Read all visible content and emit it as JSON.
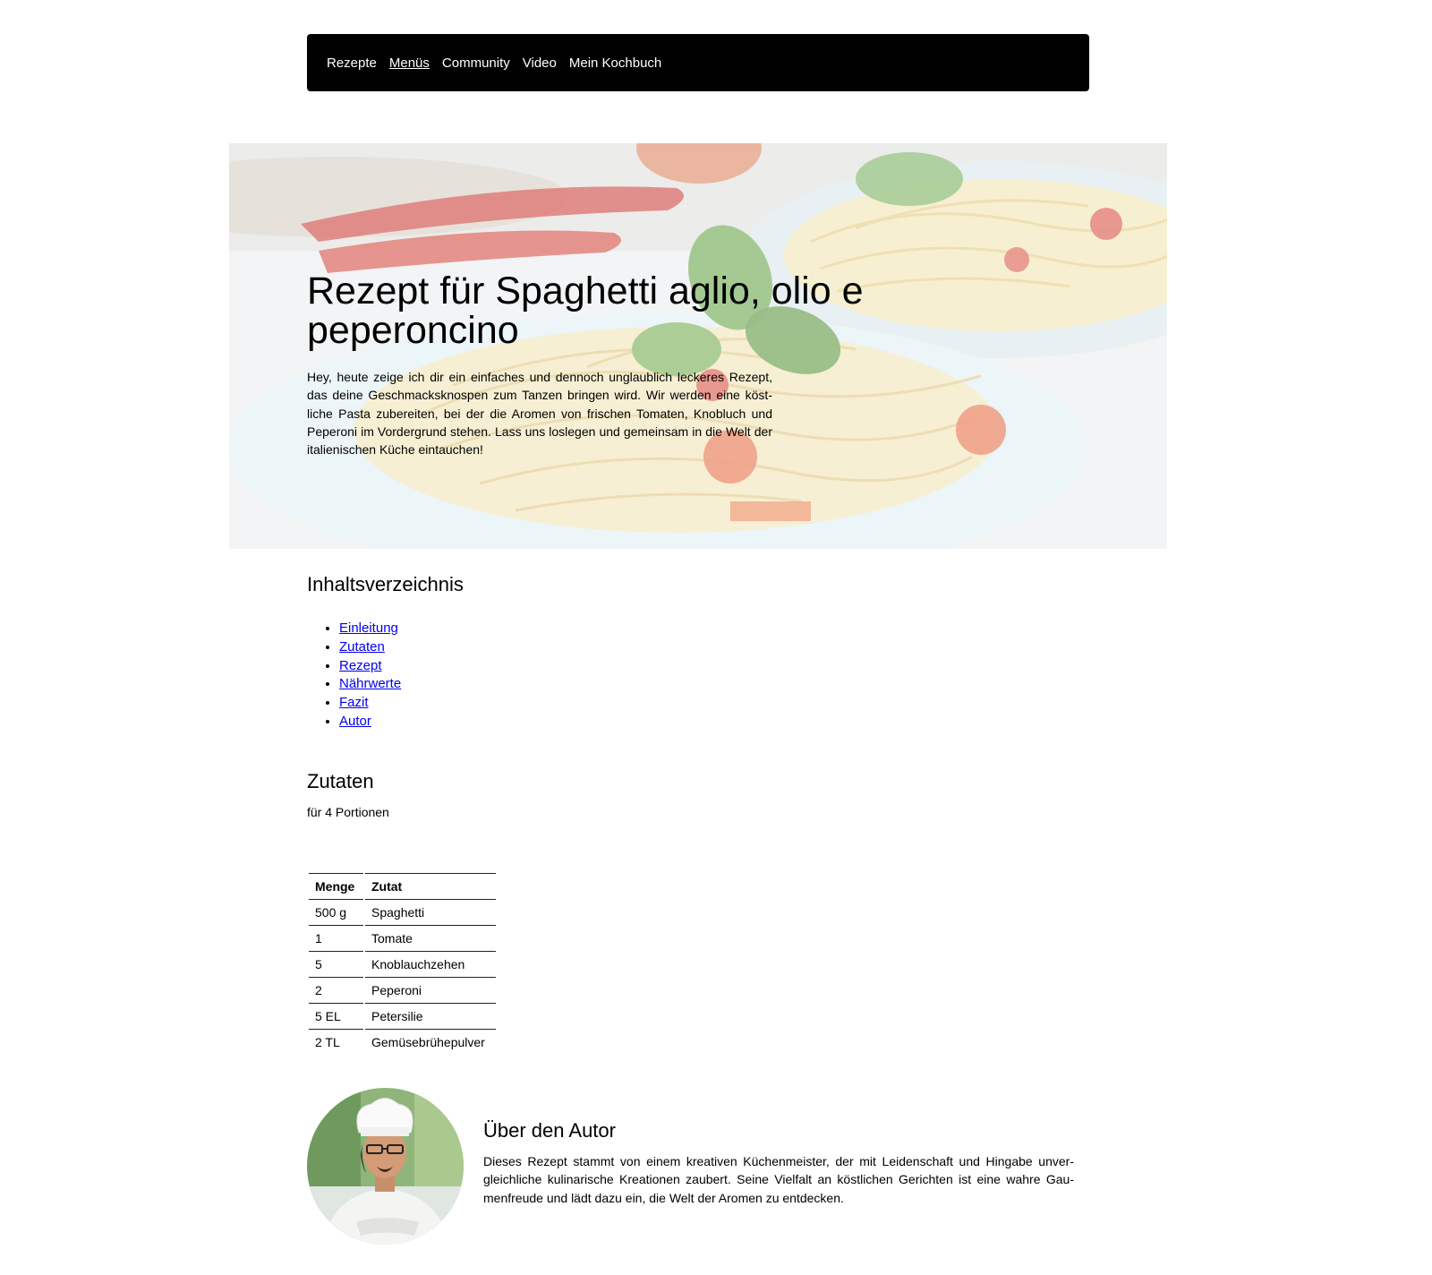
{
  "nav": {
    "items": [
      {
        "label": "Rezepte",
        "active": false
      },
      {
        "label": "Menüs",
        "active": true
      },
      {
        "label": "Community",
        "active": false
      },
      {
        "label": "Video",
        "active": false
      },
      {
        "label": "Mein Kochbuch",
        "active": false
      }
    ]
  },
  "hero": {
    "title": "Rezept für Spaghetti aglio, olio e peperoncino",
    "text": "Hey, heute zeige ich dir ein einfaches und dennoch unglaublich leckeres Rezept, das deine Geschmacksknospen zum Tanzen bringen wird. Wir werden eine köst-liche Pasta zubereiten, bei der die Aromen von frischen Tomaten, Knobluch und Peperoni im Vordergrund stehen. Lass uns loslegen und gemeinsam in die Welt der italienischen Küche eintauchen!"
  },
  "toc": {
    "heading": "Inhaltsverzeichnis",
    "items": [
      "Einleitung",
      "Zutaten",
      "Rezept",
      "Nährwerte",
      "Fazit",
      "Autor"
    ]
  },
  "ingredients": {
    "heading": "Zutaten",
    "portions": "für 4 Portionen",
    "columns": [
      "Menge",
      "Zutat"
    ],
    "rows": [
      [
        "500 g",
        "Spaghetti"
      ],
      [
        "1",
        "Tomate"
      ],
      [
        "5",
        "Knoblauchzehen"
      ],
      [
        "2",
        "Peperoni"
      ],
      [
        "5 EL",
        "Petersilie"
      ],
      [
        "2 TL",
        "Gemüsebrühepulver"
      ]
    ]
  },
  "author": {
    "heading": "Über den Autor",
    "text": "Dieses Rezept stammt von einem kreativen Küchenmeister, der mit Leidenschaft und Hingabe unver-gleichliche kulinarische Kreationen zaubert. Seine Vielfalt an köstlichen Gerichten ist eine wahre Gau-menfreude und lädt dazu ein, die Welt der Aromen zu entdecken."
  },
  "colors": {
    "nav_background": "#000000",
    "link": "#0000ee"
  }
}
